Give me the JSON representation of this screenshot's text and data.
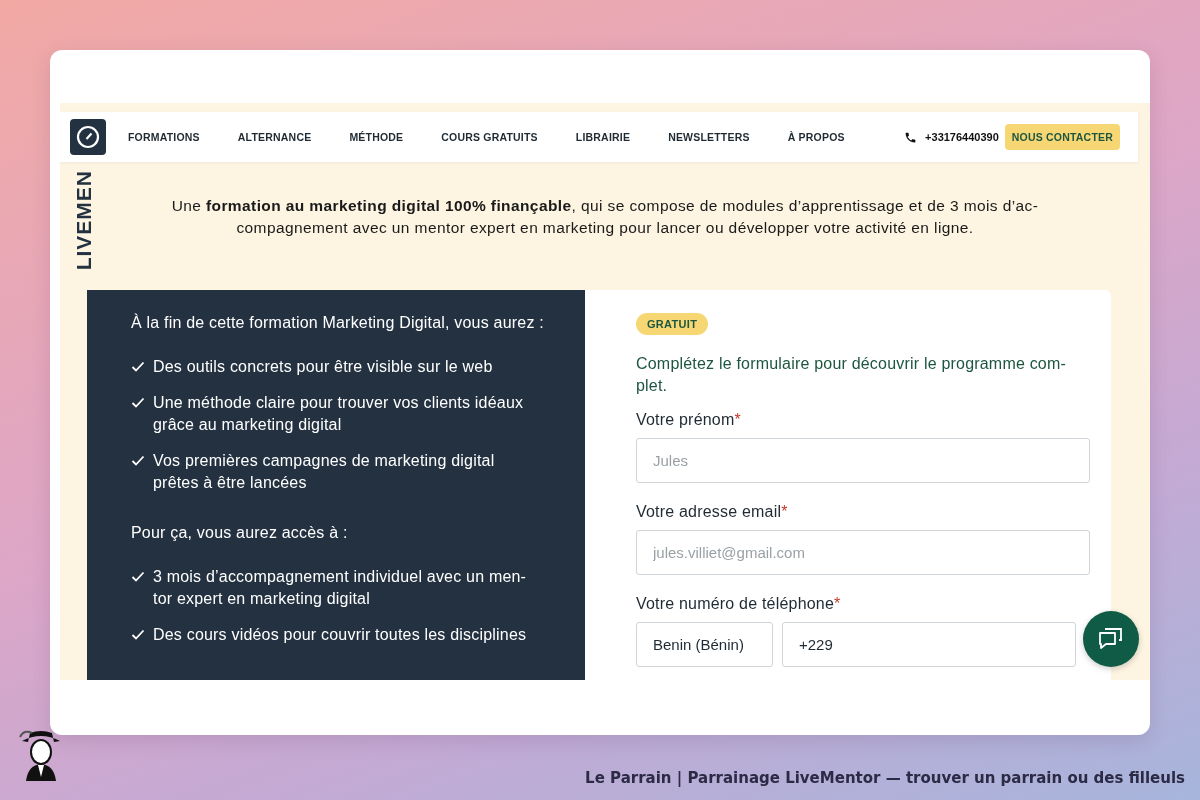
{
  "brand_vertical": "LIVEMEN",
  "nav": {
    "items": [
      "FORMATIONS",
      "ALTERNANCE",
      "MÉTHODE",
      "COURS GRATUITS",
      "LIBRAIRIE",
      "NEWSLETTERS",
      "À PROPOS"
    ],
    "phone": "+33176440390",
    "contact_button": "NOUS CONTACTER"
  },
  "hero": {
    "intro": "Une **formation au marketing digital 100% finançable**, qui se compose de modules d’apprentissage et de 3 mois d’ac-compagnement avec un mentor expert en marketing pour lancer ou développer votre activité en ligne."
  },
  "outcomes": {
    "intro": "À la fin de cette formation Marketing Digital, vous aurez :",
    "items": [
      "Des outils concrets pour être visible sur le web",
      "Une méthode claire pour trouver vos clients idéaux grâce au marketing digital",
      "Vos premières campagnes de marketing digital prêtes à être lancées"
    ],
    "access_intro": "Pour ça, vous aurez accès à :",
    "access_items": [
      "3 mois d’accompagnement individuel avec un men-tor expert en marketing digital",
      "Des cours vidéos pour couvrir toutes les disciplines"
    ]
  },
  "form": {
    "badge": "GRATUIT",
    "lead": "Complétez le formulaire pour découvrir le programme com-plet.",
    "fields": [
      {
        "kind": "text",
        "label": "Votre prénom",
        "required_mark": "*",
        "placeholder": "Jules"
      },
      {
        "kind": "text",
        "label": "Votre adresse email",
        "required_mark": "*",
        "placeholder": "jules.villiet@gmail.com"
      },
      {
        "kind": "phone",
        "label": "Votre numéro de téléphone",
        "required_mark": "*",
        "country": "Benin (Bénin)",
        "value": "+229"
      }
    ]
  },
  "caption": "Le Parrain | Parrainage LiveMentor — trouver un parrain ou des filleuls"
}
